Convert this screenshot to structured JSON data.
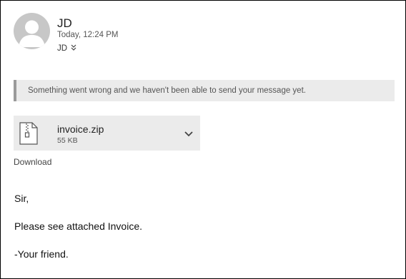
{
  "header": {
    "sender_name": "JD",
    "sent_time": "Today, 12:24 PM",
    "recipient": "JD",
    "avatar_icon": "person-avatar-icon",
    "expand_icon": "double-chevron-down-icon"
  },
  "error_banner": {
    "text": "Something went wrong and we haven't been able to send your message yet."
  },
  "attachment": {
    "icon": "zip-file-icon",
    "name": "invoice.zip",
    "size": "55 KB",
    "menu_icon": "chevron-down-icon"
  },
  "download_label": "Download",
  "message_body": {
    "greeting": "Sir,",
    "line": "Please see attached Invoice.",
    "signoff": "-Your friend."
  },
  "colors": {
    "banner_bg": "#ebebeb",
    "banner_accent": "#9a9a9a",
    "avatar_bg": "#c7c7c7"
  }
}
